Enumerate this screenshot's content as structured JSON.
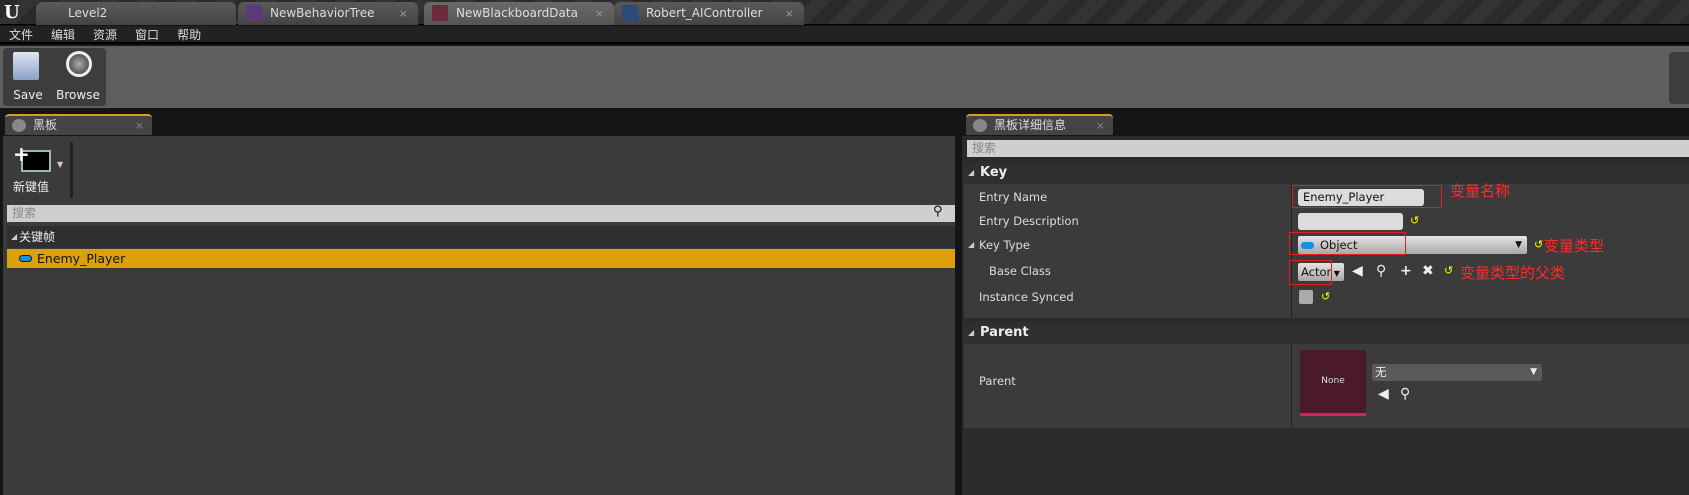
{
  "tabs": [
    {
      "label": "Level2"
    },
    {
      "label": "NewBehaviorTree"
    },
    {
      "label": "NewBlackboardData"
    },
    {
      "label": "Robert_AIController"
    }
  ],
  "menu": [
    "文件",
    "编辑",
    "资源",
    "窗口",
    "帮助"
  ],
  "toolbar": {
    "save": "Save",
    "browse": "Browse"
  },
  "blackboard": {
    "tab": "黑板",
    "new_key": "新键值",
    "search_placeholder": "搜索",
    "category": "关键帧",
    "keys": [
      {
        "name": "Enemy_Player"
      }
    ]
  },
  "details": {
    "tab": "黑板详细信息",
    "search_placeholder": "搜索",
    "key_section": "Key",
    "entry_name_label": "Entry Name",
    "entry_name": "Enemy_Player",
    "entry_desc_label": "Entry Description",
    "entry_desc": "",
    "key_type_label": "Key Type",
    "key_type": "Object",
    "base_class_label": "Base Class",
    "base_class": "Actor",
    "instance_synced_label": "Instance Synced",
    "instance_synced": false,
    "parent_section": "Parent",
    "parent_label": "Parent",
    "parent_thumb": "None",
    "parent_value": "无"
  },
  "annotations": {
    "name": "变量名称",
    "type": "变量类型",
    "parent_class": "变量类型的父类"
  },
  "colors": {
    "selection": "#dca10a",
    "annotation": "#ff2a2a",
    "parent_thumb": "#4a1a2a"
  }
}
